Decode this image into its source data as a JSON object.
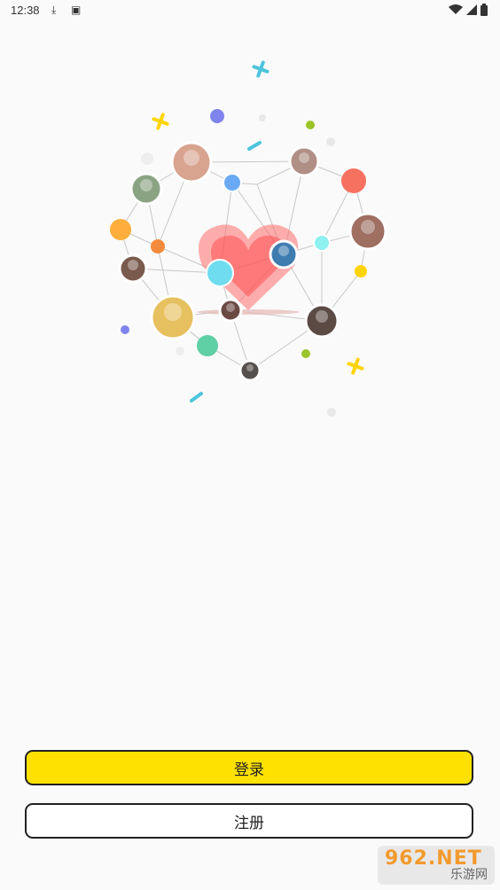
{
  "status_bar": {
    "time": "12:38",
    "left_icons": [
      "download-icon",
      "app-notification-icon"
    ],
    "right_icons": [
      "wifi-icon",
      "signal-icon",
      "battery-icon"
    ]
  },
  "illustration": {
    "subject": "network-heart-icon",
    "colors": {
      "heart": "#ff6b6b",
      "line": "#c8c8c8"
    }
  },
  "buttons": {
    "login": "登录",
    "register": "注册"
  },
  "colors": {
    "accent": "#ffe100",
    "border": "#222222",
    "background": "#fafafa"
  },
  "watermark": {
    "top": "962.NET",
    "bottom": "乐游网"
  }
}
